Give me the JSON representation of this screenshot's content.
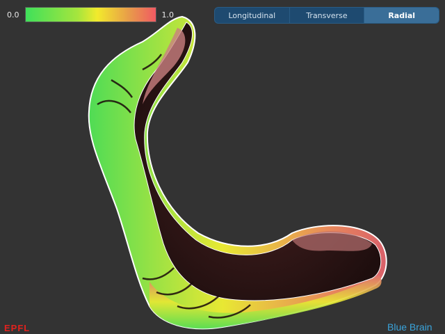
{
  "colorbar": {
    "min_label": "0.0",
    "max_label": "1.0"
  },
  "tabs": [
    {
      "label": "Longitudinal",
      "active": false
    },
    {
      "label": "Transverse",
      "active": false
    },
    {
      "label": "Radial",
      "active": true
    }
  ],
  "logos": {
    "left": "EPFL",
    "right": "Blue Brain"
  },
  "colors": {
    "background": "#333333",
    "tab_active": "#3a6e98",
    "tab_inactive": "#1e4a70",
    "scale_low": "#3fe05a",
    "scale_mid": "#f2ea2c",
    "scale_high": "#f05a63",
    "interior": "#2a1414",
    "epfl_red": "#e2221e",
    "bluebrain_blue": "#3aa4dc"
  }
}
